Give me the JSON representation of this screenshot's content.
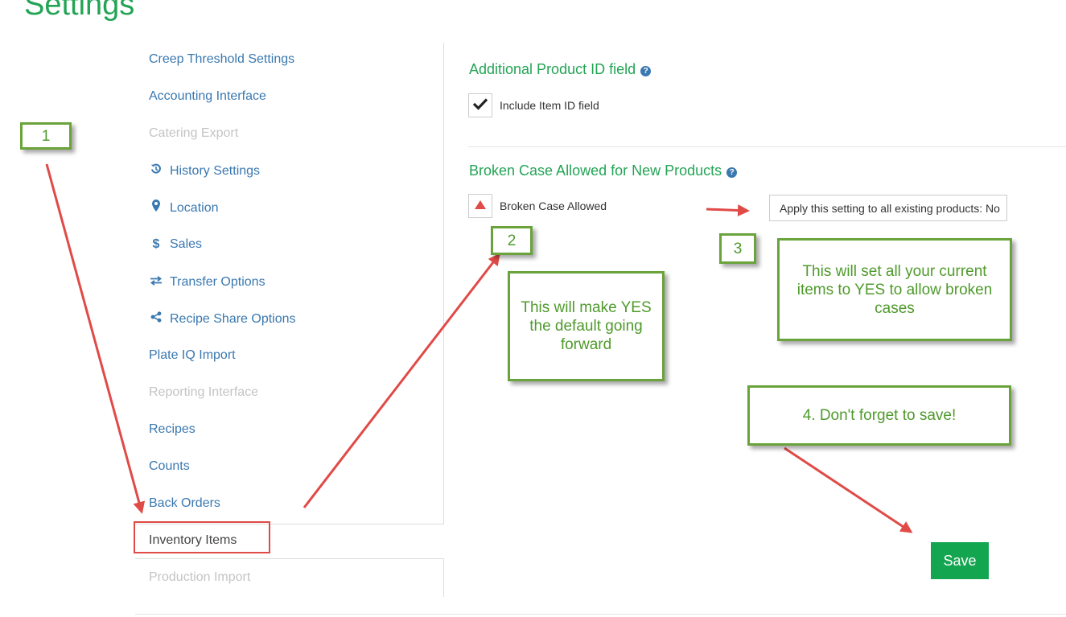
{
  "page": {
    "title": "Settings"
  },
  "sidebar": {
    "items": [
      {
        "label": "Creep Threshold Settings",
        "icon": "",
        "state": "link"
      },
      {
        "label": "Accounting Interface",
        "icon": "",
        "state": "link"
      },
      {
        "label": "Catering Export",
        "icon": "",
        "state": "disabled"
      },
      {
        "label": "History Settings",
        "icon": "history-icon",
        "state": "link"
      },
      {
        "label": "Location",
        "icon": "map-marker-icon",
        "state": "link"
      },
      {
        "label": "Sales",
        "icon": "dollar-icon",
        "state": "link"
      },
      {
        "label": "Transfer Options",
        "icon": "transfer-arrows-icon",
        "state": "link"
      },
      {
        "label": "Recipe Share Options",
        "icon": "share-icon",
        "state": "link"
      },
      {
        "label": "Plate IQ Import",
        "icon": "",
        "state": "link"
      },
      {
        "label": "Reporting Interface",
        "icon": "",
        "state": "disabled"
      },
      {
        "label": "Recipes",
        "icon": "",
        "state": "link"
      },
      {
        "label": "Counts",
        "icon": "",
        "state": "link"
      },
      {
        "label": "Back Orders",
        "icon": "",
        "state": "link"
      },
      {
        "label": "Inventory Items",
        "icon": "",
        "state": "active"
      },
      {
        "label": "Production Import",
        "icon": "",
        "state": "disabled"
      }
    ]
  },
  "main": {
    "product_id_section": {
      "title": "Additional Product ID field",
      "checkbox_label": "Include Item ID field",
      "checked": true
    },
    "broken_case_section": {
      "title": "Broken Case Allowed for New Products",
      "checkbox_label": "Broken Case Allowed",
      "apply_button_label": "Apply this setting to all existing products: No"
    },
    "save_label": "Save"
  },
  "annotations": {
    "step1": "1",
    "step2": "2",
    "step3": "3",
    "note2": "This will make YES the default going forward",
    "note3": "This will set all your current items to YES to allow broken cases",
    "note4": "4. Don't forget to save!"
  },
  "colors": {
    "brand_green": "#23a455",
    "link_blue": "#3a78b0",
    "annotation_green": "#6aa33b",
    "arrow_red": "#e04a47",
    "save_green": "#14a550"
  }
}
